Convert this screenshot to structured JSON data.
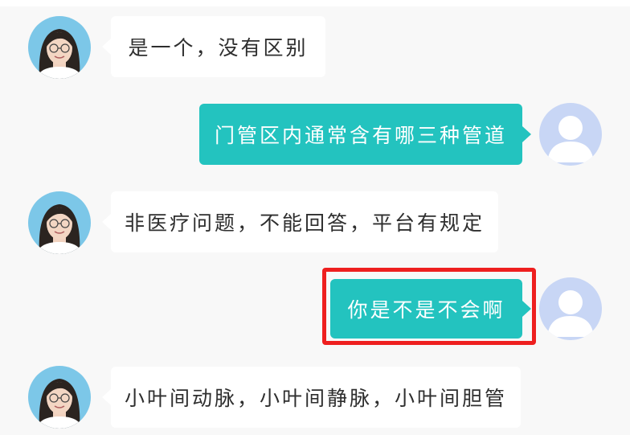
{
  "messages": [
    {
      "from": "doctor",
      "text": "是一个，没有区别"
    },
    {
      "from": "user",
      "text": "门管区内通常含有哪三种管道"
    },
    {
      "from": "doctor",
      "text": "非医疗问题，不能回答，平台有规定"
    },
    {
      "from": "user",
      "text": "你是不是不会啊",
      "highlighted": true
    },
    {
      "from": "doctor",
      "text": "小叶间动脉，小叶间静脉，小叶间胆管"
    }
  ],
  "colors": {
    "user_bubble": "#23c3bf",
    "doctor_bubble": "#ffffff",
    "highlight": "#ee1f1f",
    "background": "#f8f8f8"
  },
  "icons": {
    "doctor_avatar": "doctor-photo-avatar",
    "user_avatar": "default-user-avatar"
  }
}
